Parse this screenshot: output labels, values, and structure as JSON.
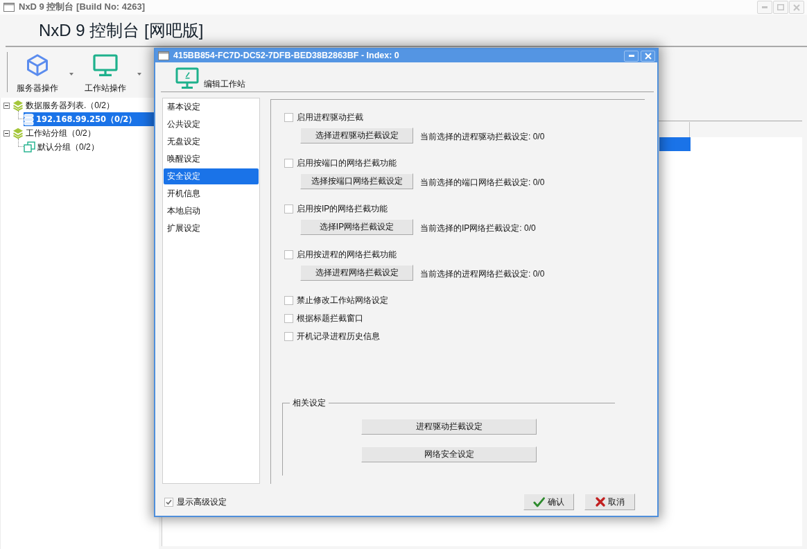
{
  "window": {
    "title": "NxD 9 控制台 [Build No: 4263]"
  },
  "header": {
    "title": "NxD 9 控制台 [网吧版]"
  },
  "toolbar": [
    {
      "label": "服务器操作",
      "kind": "server"
    },
    {
      "label": "工作站操作",
      "kind": "workstation"
    }
  ],
  "tree": [
    {
      "label": "数据服务器列表.（0/2）",
      "kind": "list",
      "expanded": true,
      "selected": false,
      "children": [
        {
          "label": "192.168.99.250（0/2）",
          "kind": "server",
          "selected": true
        }
      ]
    },
    {
      "label": "工作站分组（0/2）",
      "kind": "list",
      "expanded": true,
      "selected": false,
      "children": [
        {
          "label": "默认分组（0/2）",
          "kind": "group",
          "selected": false
        }
      ]
    }
  ],
  "table": {
    "rows": [
      {
        "selected": true
      }
    ]
  },
  "dialog": {
    "title": "415BB854-FC7D-DC52-7DFB-BED38B2863BF - Index: 0",
    "header": "编辑工作站",
    "nav": [
      {
        "label": "基本设定",
        "selected": false
      },
      {
        "label": "公共设定",
        "selected": false
      },
      {
        "label": "无盘设定",
        "selected": false
      },
      {
        "label": "唤醒设定",
        "selected": false
      },
      {
        "label": "安全设定",
        "selected": true
      },
      {
        "label": "开机信息",
        "selected": false
      },
      {
        "label": "本地启动",
        "selected": false
      },
      {
        "label": "扩展设定",
        "selected": false
      }
    ],
    "settings": [
      {
        "kind": "picker",
        "label": "启用进程驱动拦截",
        "checked": false,
        "button": "选择进程驱动拦截设定",
        "status": "当前选择的进程驱动拦截设定: 0/0"
      },
      {
        "kind": "picker",
        "label": "启用按端口的网络拦截功能",
        "checked": false,
        "button": "选择按端口网络拦截设定",
        "status": "当前选择的端口网络拦截设定: 0/0"
      },
      {
        "kind": "picker",
        "label": "启用按IP的网络拦截功能",
        "checked": false,
        "button": "选择IP网络拦截设定",
        "status": "当前选择的IP网络拦截设定: 0/0"
      },
      {
        "kind": "picker",
        "label": "启用按进程的网络拦截功能",
        "checked": false,
        "button": "选择进程网络拦截设定",
        "status": "当前选择的进程网络拦截设定: 0/0"
      },
      {
        "kind": "checkbox",
        "label": "禁止修改工作站网络设定",
        "checked": false
      },
      {
        "kind": "checkbox",
        "label": "根据标题拦截窗口",
        "checked": false
      },
      {
        "kind": "checkbox",
        "label": "开机记录进程历史信息",
        "checked": false
      }
    ],
    "related": {
      "title": "相关设定",
      "buttons": [
        "进程驱动拦截设定",
        "网络安全设定"
      ]
    },
    "show_advanced": {
      "label": "显示高级设定",
      "checked": true
    },
    "buttons": [
      {
        "label": "确认",
        "kind": "ok"
      },
      {
        "label": "取消",
        "kind": "cancel"
      }
    ]
  }
}
